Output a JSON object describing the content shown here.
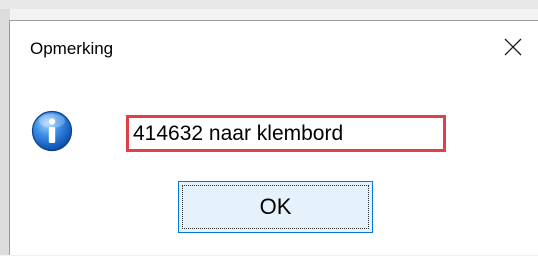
{
  "dialog": {
    "title": "Opmerking",
    "message": "414632 naar klembord",
    "ok_label": "OK",
    "icon": "information-icon",
    "close_icon": "close-icon",
    "highlight_color": "#e0404a",
    "button_accent": "#0078d7"
  }
}
